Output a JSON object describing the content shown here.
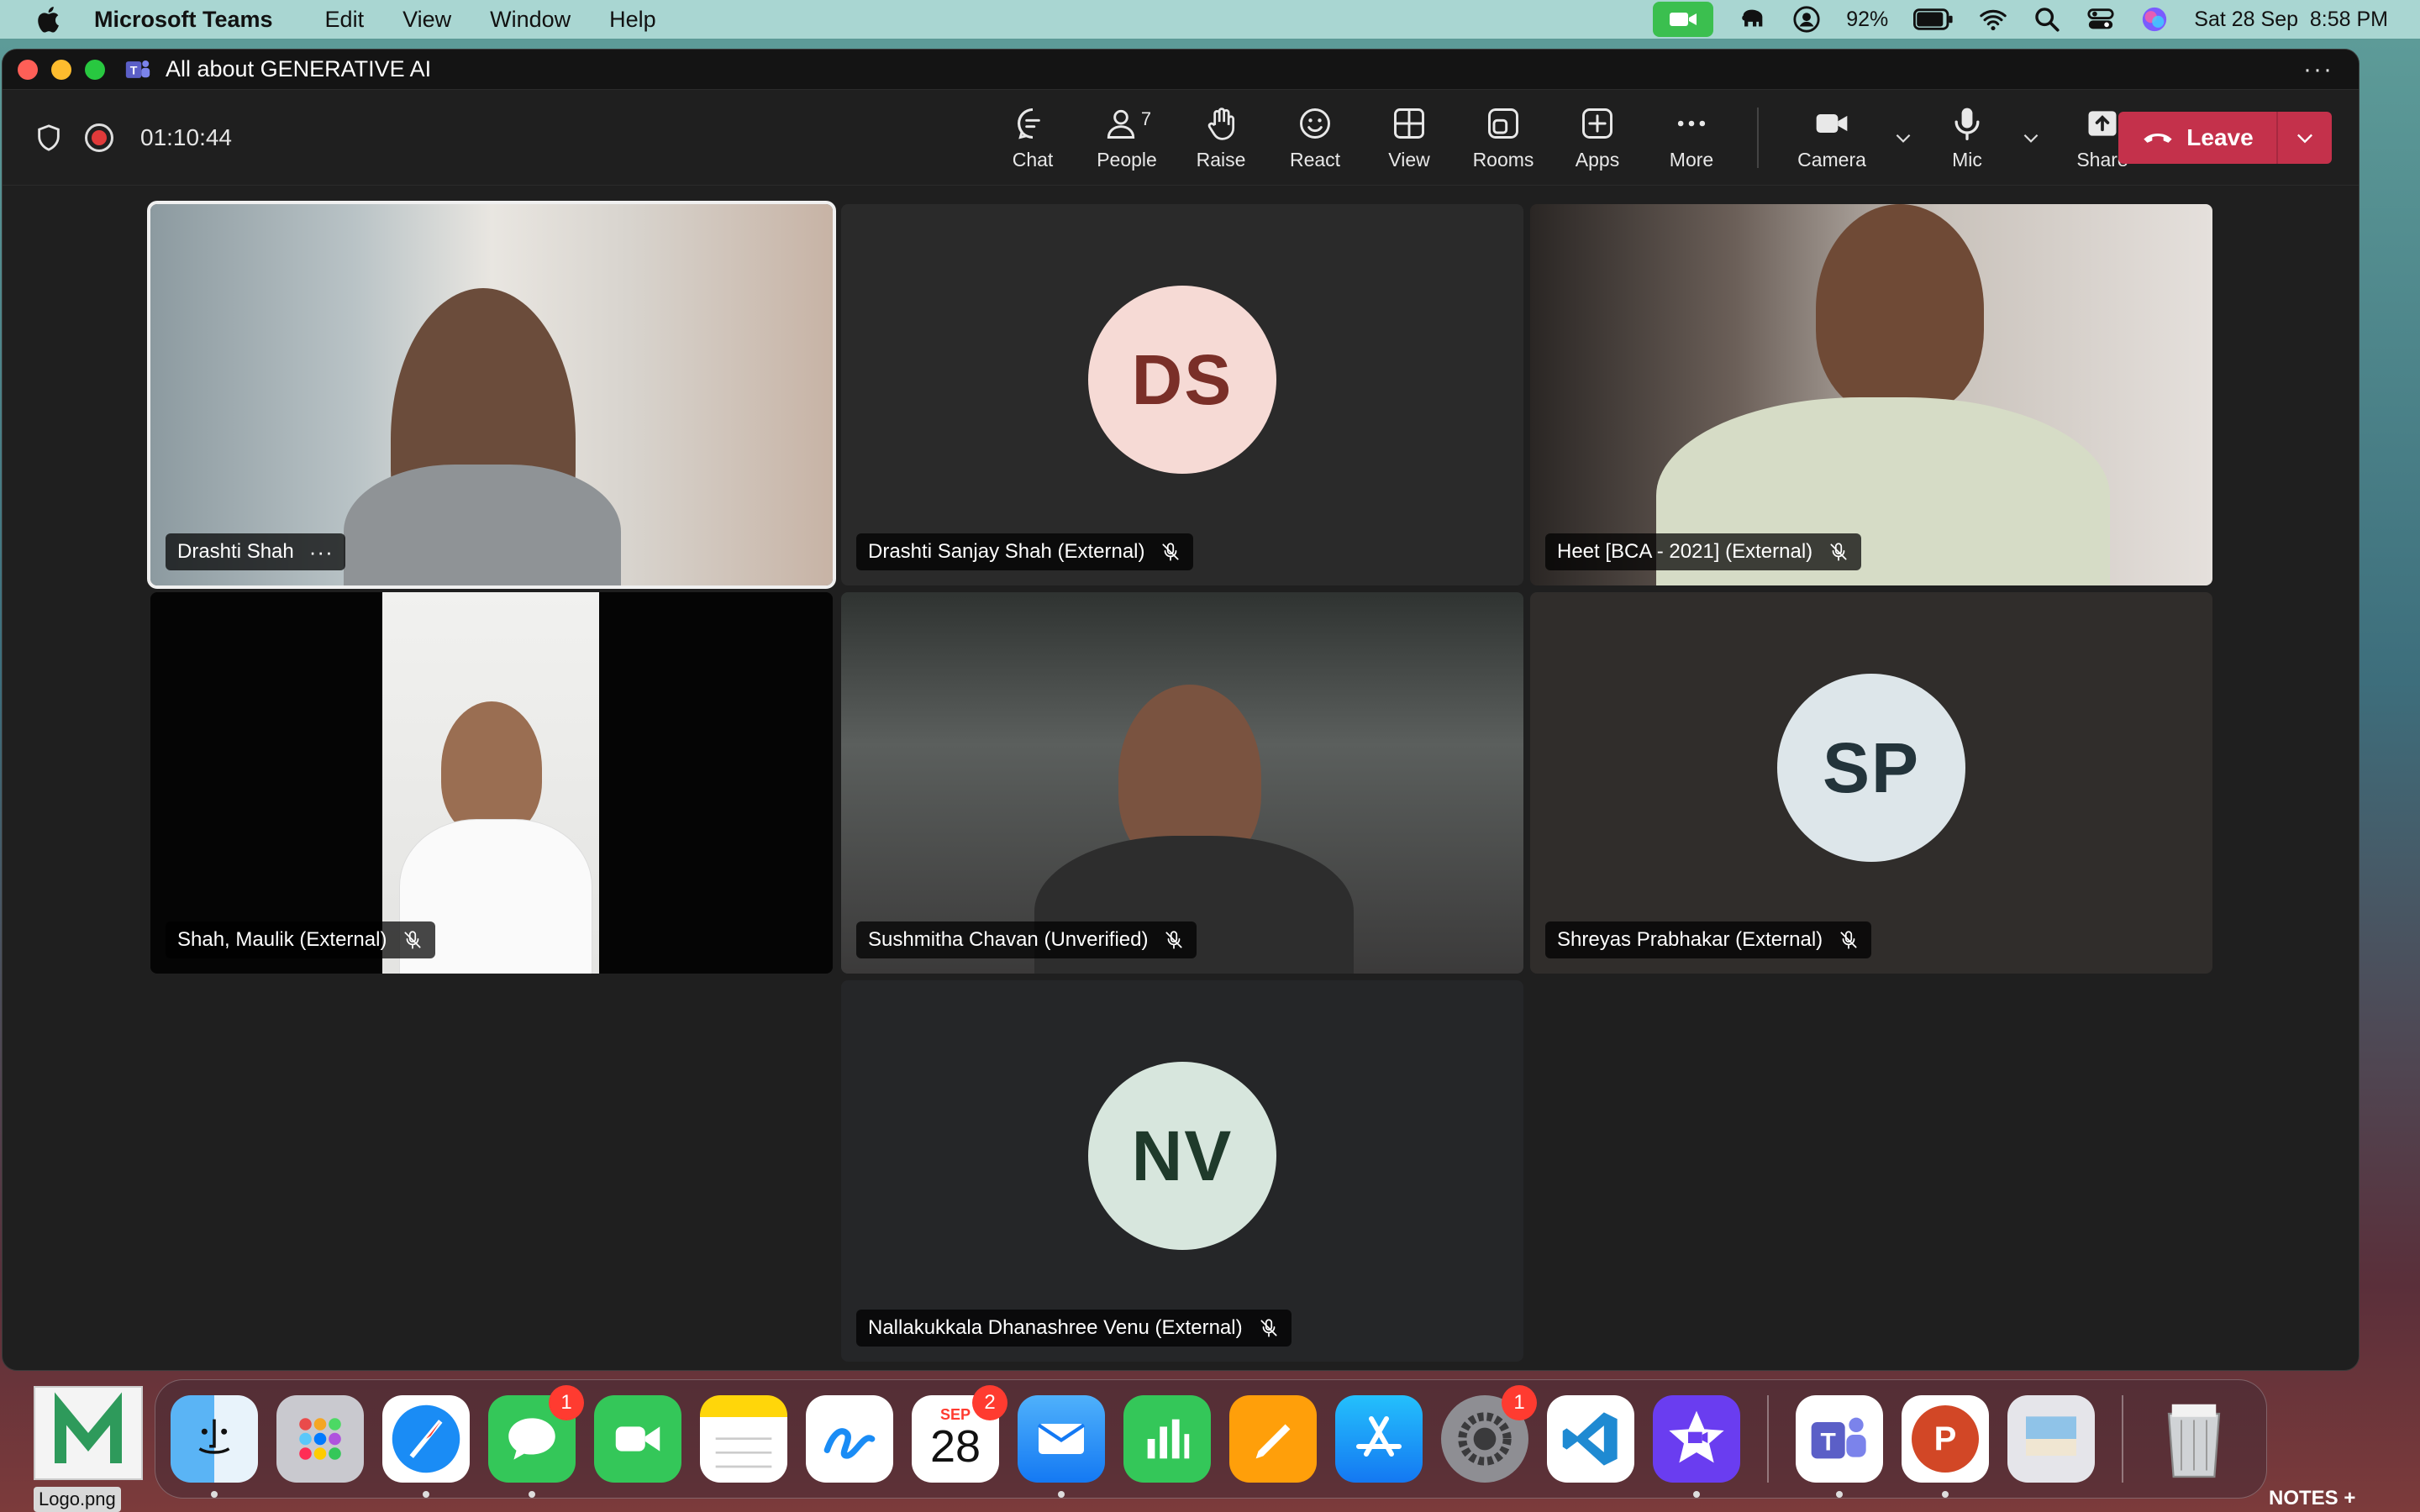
{
  "menubar": {
    "app_name": "Microsoft Teams",
    "menus": [
      "Edit",
      "View",
      "Window",
      "Help"
    ],
    "battery": "92%",
    "datetime": "Sat 28 Sep  8:58 PM"
  },
  "window": {
    "title": "All about GENERATIVE AI",
    "timer": "01:10:44",
    "toolbar": {
      "chat": "Chat",
      "people": "People",
      "people_count": "7",
      "raise": "Raise",
      "react": "React",
      "view": "View",
      "rooms": "Rooms",
      "apps": "Apps",
      "more": "More",
      "camera": "Camera",
      "mic": "Mic",
      "share": "Share",
      "leave": "Leave"
    }
  },
  "participants": [
    {
      "name": "Drashti Shah",
      "video": true
    },
    {
      "name": "Drashti Sanjay Shah (External)",
      "initials": "DS",
      "avatar_bg": "#f6dad5",
      "avatar_fg": "#7a2f28"
    },
    {
      "name": "Heet [BCA - 2021] (External)",
      "video": true
    },
    {
      "name": "Shah, Maulik (External)",
      "video": true
    },
    {
      "name": "Sushmitha Chavan (Unverified)",
      "video": true
    },
    {
      "name": "Shreyas Prabhakar (External)",
      "initials": "SP",
      "avatar_bg": "#dde6ea",
      "avatar_fg": "#23343b"
    },
    {
      "name": "Nallakukkala Dhanashree Venu (External)",
      "initials": "NV",
      "avatar_bg": "#d7e6dd",
      "avatar_fg": "#1f3a2b"
    }
  ],
  "dock": {
    "calendar_month": "SEP",
    "calendar_day": "28",
    "badges": {
      "messages": "1",
      "calendar": "2",
      "settings": "1"
    },
    "powerpoint_letter": "P"
  },
  "desktop": {
    "file_label": "Logo.png",
    "notes_label": "NOTES +"
  }
}
